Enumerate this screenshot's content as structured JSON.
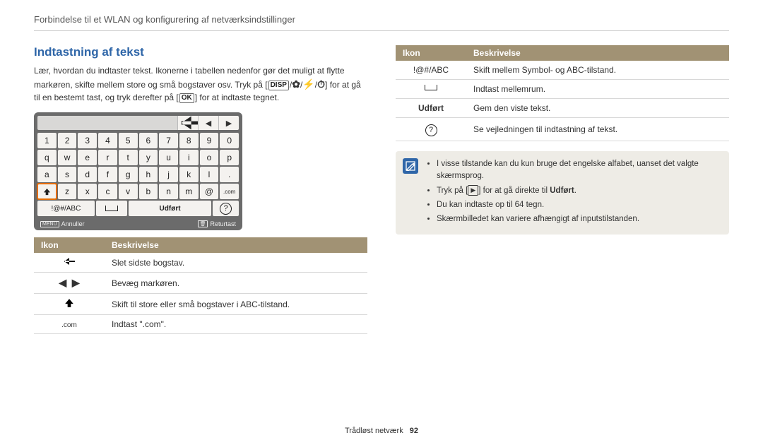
{
  "breadcrumb": "Forbindelse til et WLAN og konfigurering af netværksindstillinger",
  "section_title": "Indtastning af tekst",
  "intro_a": "Lær, hvordan du indtaster tekst. Ikonerne i tabellen nedenfor gør det muligt at flytte markøren, skifte mellem store og små bogstaver osv. Tryk på [",
  "intro_disp": "DISP",
  "intro_b": "] for at gå til en bestemt tast, og tryk derefter på [",
  "intro_ok": "OK",
  "intro_c": "] for at indtaste tegnet.",
  "keyboard": {
    "rows": [
      [
        "1",
        "2",
        "3",
        "4",
        "5",
        "6",
        "7",
        "8",
        "9",
        "0"
      ],
      [
        "q",
        "w",
        "e",
        "r",
        "t",
        "y",
        "u",
        "i",
        "o",
        "p"
      ],
      [
        "a",
        "s",
        "d",
        "f",
        "g",
        "h",
        "j",
        "k",
        "l",
        "."
      ],
      [
        "↑",
        "z",
        "x",
        "c",
        "v",
        "b",
        "n",
        "m",
        "@",
        ".com"
      ]
    ],
    "highlight_row": 3,
    "highlight_col": 0,
    "bottom": {
      "symbol": "!@#/ABC",
      "done": "Udført"
    },
    "footer": {
      "left_tag": "MENU",
      "left": "Annuller",
      "right_tag": "🗑",
      "right": "Returtast"
    }
  },
  "table_headers": {
    "icon": "Ikon",
    "desc": "Beskrivelse"
  },
  "left_table": [
    {
      "icon": "back-bold-icon",
      "text": "Slet sidste bogstav."
    },
    {
      "icon": "left-right-icon",
      "text": "Bevæg markøren."
    },
    {
      "icon": "shift-icon",
      "text": "Skift til store eller små bogstaver i ABC-tilstand."
    },
    {
      "icon": "dotcom-icon",
      "label": ".com",
      "text": "Indtast \".com\"."
    }
  ],
  "right_table": [
    {
      "icon": "symbol-abc",
      "label": "!@#/ABC",
      "text": "Skift mellem Symbol- og ABC-tilstand."
    },
    {
      "icon": "space-icon",
      "text": "Indtast mellemrum."
    },
    {
      "icon": "done-label",
      "label": "Udført",
      "text": "Gem den viste tekst."
    },
    {
      "icon": "help-icon",
      "label": "?",
      "text": "Se vejledningen til indtastning af tekst."
    }
  ],
  "notes": {
    "n1": "I visse tilstande kan du kun bruge det engelske alfabet, uanset det valgte skærmsprog.",
    "n2a": "Tryk på [",
    "n2b": "] for at gå direkte til ",
    "n2_done": "Udført",
    "n2c": ".",
    "n3": "Du kan indtaste op til 64 tegn.",
    "n4": "Skærmbilledet kan variere afhængigt af inputstilstanden."
  },
  "footer": {
    "section": "Trådløst netværk",
    "page": "92"
  }
}
